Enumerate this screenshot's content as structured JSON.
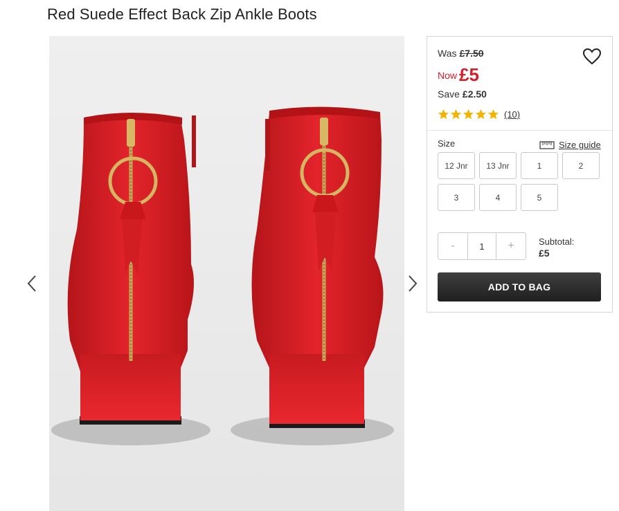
{
  "product": {
    "title": "Red Suede Effect Back Zip Ankle Boots",
    "image_icon": "product-photo-red-ankle-boots"
  },
  "gallery": {
    "prev_icon": "chevron-left-icon",
    "next_icon": "chevron-right-icon"
  },
  "price": {
    "was_label": "Was",
    "was_value": "£7.50",
    "now_label": "Now",
    "now_value": "£5",
    "save_label": "Save",
    "save_value": "£2.50",
    "now_color": "#d3202a"
  },
  "wishlist": {
    "icon": "heart-icon"
  },
  "rating": {
    "stars": 5,
    "star_color": "#f5b301",
    "reviews": "(10)"
  },
  "size": {
    "label": "Size",
    "guide_label": "Size guide",
    "guide_icon": "ruler-icon",
    "options": [
      "12 Jnr",
      "13 Jnr",
      "1",
      "2",
      "3",
      "4",
      "5"
    ]
  },
  "quantity": {
    "minus": "-",
    "value": "1",
    "plus": "+"
  },
  "subtotal": {
    "label": "Subtotal:",
    "value": "£5"
  },
  "cart": {
    "add_label": "ADD TO BAG"
  }
}
